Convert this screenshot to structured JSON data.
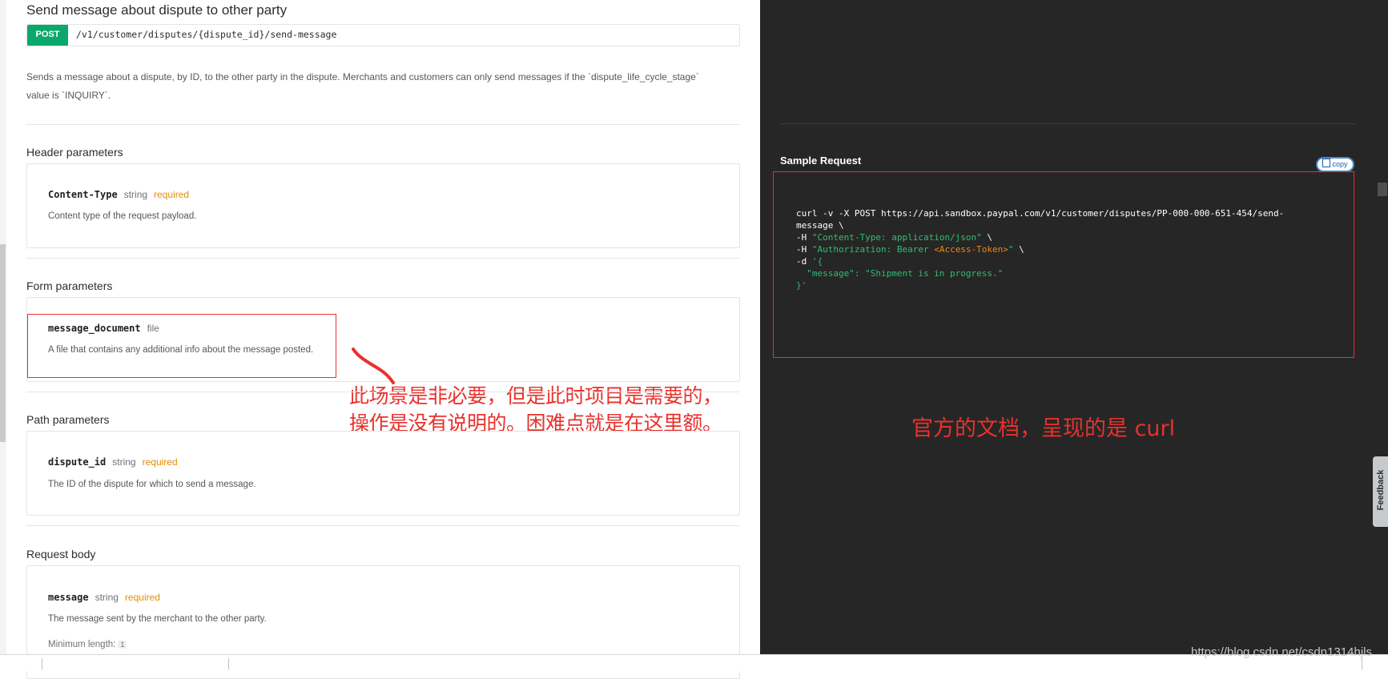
{
  "endpoint": {
    "title": "Send message about dispute to other party",
    "method": "POST",
    "path": "/v1/customer/disputes/{dispute_id}/send-message",
    "description_line1": "Sends a message about a dispute, by ID, to the other party in the dispute. Merchants and customers can only send messages if the `dispute_life_cycle_stage`",
    "description_line2": "value is `INQUIRY`."
  },
  "header_params": {
    "title": "Header parameters",
    "name": "Content-Type",
    "type": "string",
    "required": "required",
    "description": "Content type of the request payload."
  },
  "form_params": {
    "title": "Form parameters",
    "name": "message_document",
    "type": "file",
    "description": "A file that contains any additional info about the message posted."
  },
  "path_params": {
    "title": "Path parameters",
    "name": "dispute_id",
    "type": "string",
    "required": "required",
    "description": "The ID of the dispute for which to send a message."
  },
  "request_body": {
    "title": "Request body",
    "name": "message",
    "type": "string",
    "required": "required",
    "description": "The message sent by the merchant to the other party.",
    "min_length_label": "Minimum length:",
    "min_length_value": "1"
  },
  "annotation_left": {
    "line1": "此场景是非必要，但是此时项目是需要的，",
    "line2": "操作是没有说明的。困难点就是在这里额。"
  },
  "sample": {
    "title": "Sample Request",
    "copy_label": "copy",
    "code": {
      "line1": "curl -v -X POST https://api.sandbox.paypal.com/v1/customer/disputes/PP-000-000-651-454/send-",
      "line2": "message \\",
      "h1_flag": "-H ",
      "h1_value": "\"Content-Type: application/json\"",
      "h1_tail": " \\",
      "h2_flag": "-H ",
      "h2_value_a": "\"Authorization: Bearer ",
      "h2_token": "<Access-Token>",
      "h2_value_b": "\"",
      "h2_tail": " \\",
      "d_flag": "-d ",
      "d_open": "'{",
      "body_line": "  \"message\": \"Shipment is in progress.\"",
      "d_close": "}'"
    }
  },
  "annotation_right": "官方的文档，呈现的是 curl",
  "feedback_label": "Feedback",
  "watermark": "https://blog.csdn.net/csdn1314hjls",
  "colors": {
    "post_badge": "#0ba86b",
    "required": "#e38c00",
    "annotation": "#e8312c",
    "code_bg": "#262626",
    "code_string": "#2fbf71",
    "code_token": "#e98a15"
  },
  "icons": [
    "copy-icon",
    "red-arrow-stroke-icon"
  ]
}
